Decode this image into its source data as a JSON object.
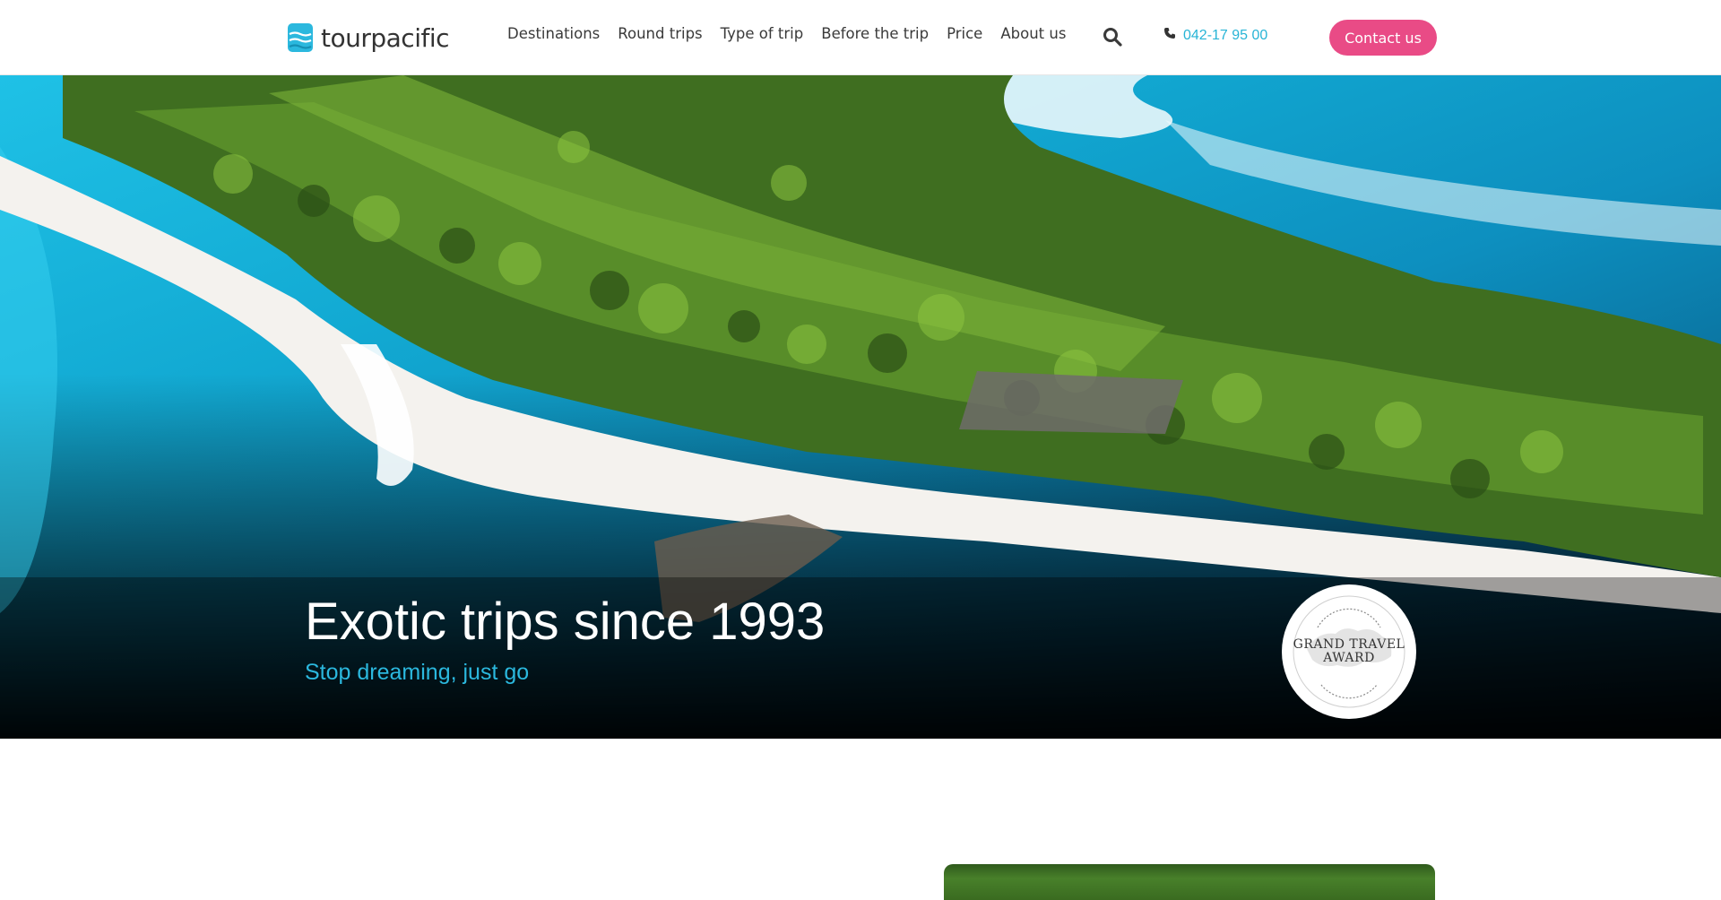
{
  "brand": {
    "name": "tourpacific",
    "colors": {
      "accent": "#27b4d6",
      "cta": "#e94b86",
      "text": "#3a3a3a"
    }
  },
  "nav": {
    "items": [
      {
        "label": "Destinations"
      },
      {
        "label": "Round trips"
      },
      {
        "label": "Type of trip"
      },
      {
        "label": "Before the trip"
      },
      {
        "label": "Price"
      },
      {
        "label": "About us"
      }
    ]
  },
  "header": {
    "search_icon": "search-icon",
    "phone_icon": "phone-icon",
    "phone_number": "042-17 95 00",
    "contact_label": "Contact us"
  },
  "hero": {
    "title": "Exotic trips since 1993",
    "subtitle": "Stop dreaming, just go"
  },
  "award": {
    "title_line1": "GRAND TRAVEL",
    "title_line2": "AWARD"
  }
}
